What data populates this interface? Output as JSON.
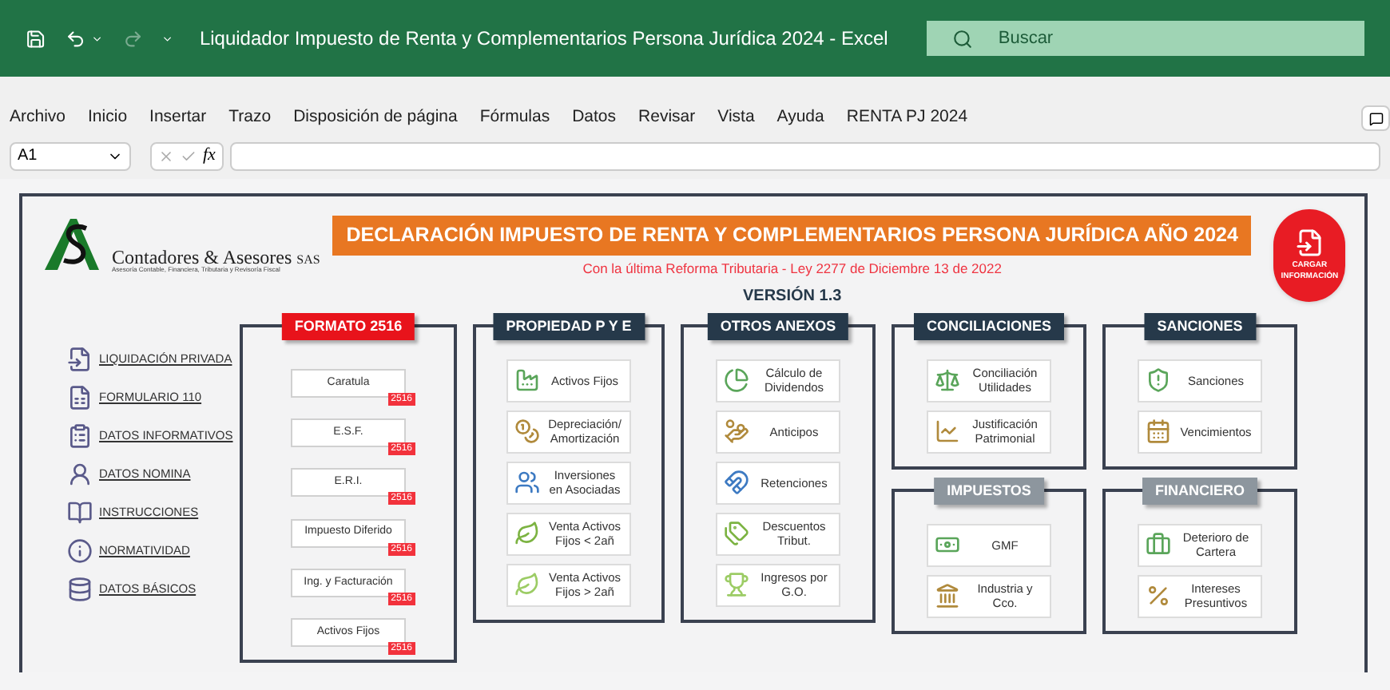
{
  "window": {
    "title": "Liquidador Impuesto de Renta y Complementarios Persona Jurídica 2024 - Excel",
    "search_placeholder": "Buscar"
  },
  "menu": [
    "Archivo",
    "Inicio",
    "Insertar",
    "Trazo",
    "Disposición de página",
    "Fórmulas",
    "Datos",
    "Revisar",
    "Vista",
    "Ayuda",
    "RENTA PJ 2024"
  ],
  "formula_bar": {
    "name_box": "A1",
    "fx": "fx"
  },
  "sheet": {
    "logo_name": "Contadores & Asesores",
    "logo_suffix": "SAS",
    "logo_tagline": "Asesoría Contable, Financiera, Tributaria y Revisoría Fiscal",
    "title": "DECLARACIÓN IMPUESTO DE RENTA Y COMPLEMENTARIOS PERSONA JURÍDICA AÑO 2024",
    "subtitle": "Con la última Reforma Tributaria - Ley 2277 de Diciembre 13 de 2022",
    "version": "VERSIÓN 1.3",
    "load_button": "CARGAR INFORMACIÓN",
    "nav": [
      "LIQUIDACIÓN PRIVADA",
      "FORMULARIO 110",
      "DATOS INFORMATIVOS",
      "DATOS NOMINA",
      "INSTRUCCIONES",
      "NORMATIVIDAD",
      "DATOS BÁSICOS"
    ],
    "groups": [
      {
        "title": "FORMATO 2516",
        "kind": "format",
        "color": "#e8131b",
        "items": [
          {
            "label": "Caratula",
            "badge": "2516"
          },
          {
            "label": "E.S.F.",
            "badge": "2516"
          },
          {
            "label": "E.R.I.",
            "badge": "2516"
          },
          {
            "label": "Impuesto Diferido",
            "badge": "2516"
          },
          {
            "label": "Ing. y Facturación",
            "badge": "2516"
          },
          {
            "label": "Activos Fijos",
            "badge": "2516"
          }
        ]
      },
      {
        "title": "PROPIEDAD P Y E",
        "kind": "icons",
        "color": "#26394a",
        "items": [
          {
            "label": "Activos Fijos"
          },
          {
            "label": "Depreciación/ Amortización"
          },
          {
            "label": "Inversiones en Asociadas"
          },
          {
            "label": "Venta Activos Fijos < 2añ"
          },
          {
            "label": "Venta Activos Fijos > 2añ"
          }
        ]
      },
      {
        "title": "OTROS ANEXOS",
        "kind": "icons",
        "color": "#26394a",
        "items": [
          {
            "label": "Cálculo de Dividendos"
          },
          {
            "label": "Anticipos"
          },
          {
            "label": "Retenciones"
          },
          {
            "label": "Descuentos Tribut."
          },
          {
            "label": "Ingresos por G.O."
          }
        ]
      },
      {
        "title": "CONCILIACIONES",
        "kind": "icons",
        "color": "#26394a",
        "items": [
          {
            "label": "Conciliación Utilidades"
          },
          {
            "label": "Justificación Patrimonial"
          }
        ]
      },
      {
        "title": "SANCIONES",
        "kind": "icons",
        "color": "#26394a",
        "items": [
          {
            "label": "Sanciones"
          },
          {
            "label": "Vencimientos"
          }
        ]
      },
      {
        "title": "IMPUESTOS",
        "kind": "icons",
        "color": "#8d969e",
        "items": [
          {
            "label": "GMF"
          },
          {
            "label": "Industria y Cco."
          }
        ]
      },
      {
        "title": "FINANCIERO",
        "kind": "icons",
        "color": "#8d969e",
        "items": [
          {
            "label": "Deterioro de Cartera"
          },
          {
            "label": "Intereses Presuntivos"
          }
        ]
      }
    ]
  }
}
